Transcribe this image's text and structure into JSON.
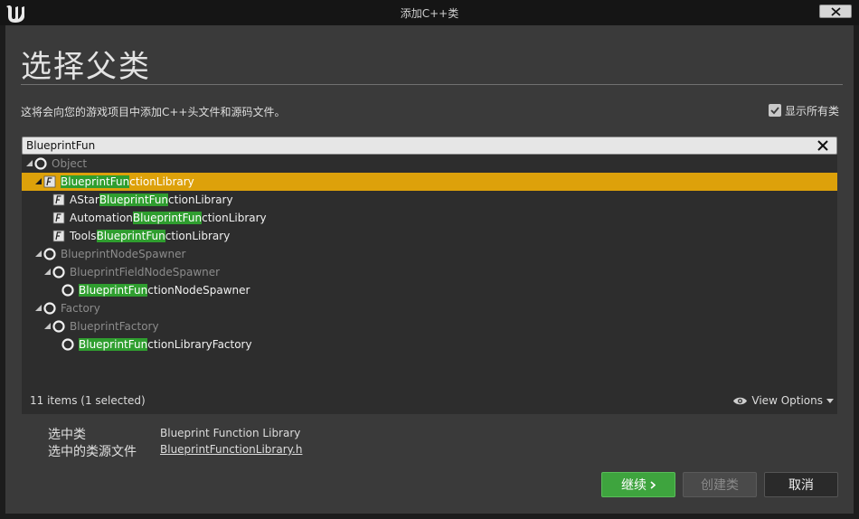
{
  "window": {
    "title": "添加C++类"
  },
  "header": {
    "heading": "选择父类",
    "description": "这将会向您的游戏项目中添加C++头文件和源码文件。",
    "show_all_label": "显示所有类",
    "show_all_checked": true
  },
  "search": {
    "value": "BlueprintFun"
  },
  "tree": {
    "rows": [
      {
        "pre": "",
        "match": "",
        "post": "Object",
        "level": 0,
        "icon": "circle-node-icon",
        "expanded": true,
        "dim": true,
        "selected": false
      },
      {
        "pre": "",
        "match": "BlueprintFun",
        "post": "ctionLibrary",
        "level": 1,
        "icon": "script-class-icon",
        "expanded": true,
        "dim": false,
        "selected": true
      },
      {
        "pre": "AStar",
        "match": "BlueprintFun",
        "post": "ctionLibrary",
        "level": 2,
        "icon": "script-class-icon",
        "expanded": false,
        "dim": false,
        "selected": false
      },
      {
        "pre": "Automation",
        "match": "BlueprintFun",
        "post": "ctionLibrary",
        "level": 2,
        "icon": "script-class-icon",
        "expanded": false,
        "dim": false,
        "selected": false
      },
      {
        "pre": "Tools",
        "match": "BlueprintFun",
        "post": "ctionLibrary",
        "level": 2,
        "icon": "script-class-icon",
        "expanded": false,
        "dim": false,
        "selected": false
      },
      {
        "pre": "",
        "match": "",
        "post": "BlueprintNodeSpawner",
        "level": 1,
        "icon": "circle-node-icon",
        "expanded": true,
        "dim": true,
        "selected": false
      },
      {
        "pre": "",
        "match": "",
        "post": "BlueprintFieldNodeSpawner",
        "level": 2,
        "icon": "circle-node-icon",
        "expanded": true,
        "dim": true,
        "selected": false
      },
      {
        "pre": "",
        "match": "BlueprintFun",
        "post": "ctionNodeSpawner",
        "level": 3,
        "icon": "circle-node-icon",
        "expanded": false,
        "dim": false,
        "selected": false
      },
      {
        "pre": "",
        "match": "",
        "post": "Factory",
        "level": 1,
        "icon": "circle-node-icon",
        "expanded": true,
        "dim": true,
        "selected": false
      },
      {
        "pre": "",
        "match": "",
        "post": "BlueprintFactory",
        "level": 2,
        "icon": "circle-node-icon",
        "expanded": true,
        "dim": true,
        "selected": false
      },
      {
        "pre": "",
        "match": "BlueprintFun",
        "post": "ctionLibraryFactory",
        "level": 3,
        "icon": "circle-node-icon",
        "expanded": false,
        "dim": false,
        "selected": false
      }
    ],
    "items_count": "11 items (1 selected)",
    "view_options_label": "View Options"
  },
  "selection": {
    "class_label": "选中类",
    "class_value": "Blueprint Function Library",
    "source_label": "选中的类源文件",
    "source_value": "BlueprintFunctionLibrary.h"
  },
  "buttons": {
    "continue_label": "继续",
    "create_label": "创建类",
    "cancel_label": "取消"
  },
  "colors": {
    "selection": "#dda10a",
    "match_highlight": "#2f9e2f",
    "continue_button": "#3ea43e"
  }
}
